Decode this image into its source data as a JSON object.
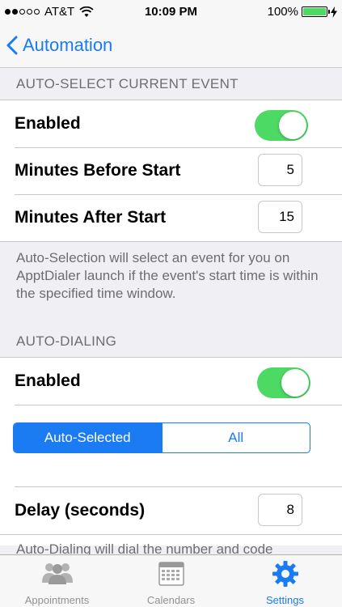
{
  "status": {
    "carrier": "AT&T",
    "time": "10:09 PM",
    "battery": "100%",
    "battery_level": 1.0
  },
  "nav": {
    "back_label": "Automation"
  },
  "auto_select": {
    "header": "AUTO-SELECT CURRENT EVENT",
    "enabled_label": "Enabled",
    "enabled": true,
    "minutes_before_label": "Minutes Before Start",
    "minutes_before_value": "5",
    "minutes_after_label": "Minutes After Start",
    "minutes_after_value": "15",
    "footer": "Auto-Selection will select an event for you on ApptDialer launch if the event's start time is within the specified time window."
  },
  "auto_dial": {
    "header": "AUTO-DIALING",
    "enabled_label": "Enabled",
    "enabled": true,
    "segments": [
      "Auto-Selected",
      "All"
    ],
    "selected_segment": 0,
    "delay_label": "Delay (seconds)",
    "delay_value": "8",
    "footer": "Auto-Dialing will dial the number and code"
  },
  "tabs": [
    {
      "label": "Appointments",
      "icon": "people-icon"
    },
    {
      "label": "Calendars",
      "icon": "calendar-icon"
    },
    {
      "label": "Settings",
      "icon": "gear-icon",
      "active": true
    }
  ],
  "colors": {
    "accent": "#1a7bf2",
    "toggle_on": "#4cd964",
    "section_text": "#6d6d72",
    "background": "#efeff4"
  }
}
